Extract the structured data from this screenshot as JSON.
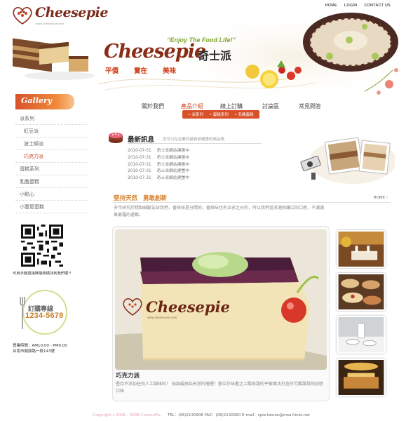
{
  "toplinks": [
    "HOME",
    "LOGIN",
    "CONTACT US"
  ],
  "logo": {
    "text": "Cheesepie",
    "url": "www.cheese-pie.com"
  },
  "banner": {
    "slogan": "“Enjoy The Food Life!”",
    "brand": "Cheesepie",
    "brand_cn": "奇士派",
    "tagline": [
      "平價",
      "實在",
      "美味"
    ]
  },
  "nav": {
    "items": [
      "關於我們",
      "產品介紹",
      "線上訂購",
      "討論區",
      "常見問答"
    ],
    "active_index": 1,
    "sub": [
      "派系列",
      "蛋糕系列",
      "乳酪蛋糕"
    ]
  },
  "gallery_label": "Gallery",
  "sidebar": [
    {
      "label": "派系列",
      "level": "top"
    },
    {
      "label": "紅豆派",
      "level": "sub"
    },
    {
      "label": "波士頓派",
      "level": "sub"
    },
    {
      "label": "巧克力派",
      "level": "sub",
      "active": true
    },
    {
      "label": "蛋糕系列",
      "level": "top"
    },
    {
      "label": "乳酪蛋糕",
      "level": "top"
    },
    {
      "label": "小點心",
      "level": "top"
    },
    {
      "label": "小豐屋蛋糕",
      "level": "top"
    }
  ],
  "qr_caption": "可用手機直接掃描條碼找到我們喔!!",
  "hotline": {
    "label": "訂購專線",
    "number": "1234-5678"
  },
  "hours": [
    "營業時間：AM10:00 - PM9:00",
    "台南市健康路一段143號"
  ],
  "news": {
    "title": "最新訊息",
    "subtitle": "您可以在這看到最新最優惠的商品唷",
    "items": [
      {
        "date": "2010-07-31",
        "text": "奇士派網站建置中"
      },
      {
        "date": "2010-07-31",
        "text": "奇士派網站建置中"
      },
      {
        "date": "2010-07-31",
        "text": "奇士派網站建置中"
      },
      {
        "date": "2010-07-31",
        "text": "奇士派網站建置中"
      },
      {
        "date": "2010-07-31",
        "text": "奇士派網站建置中"
      }
    ]
  },
  "intro": {
    "title_a": "堅持天然",
    "title_b": "勇敢創新",
    "home": "HOME",
    "text": "多年研究於精點細膩告訴我們，香與味是分開的，香與味也有正邪之分的，所以我們追求適與嫌口的口感，不濃讓東敢羅的還都。"
  },
  "feature": {
    "name": "巧克力派",
    "desc": "堅持不添加任何人工調味料！ 強調最原始天然的嗜裡！基立於味蕾之上酸與甜的平衡魔法打造芬芳酸甜甜的初戀口味",
    "brand": "Cheesepie",
    "brand_url": "www.cheese-pie.com"
  },
  "footer": {
    "copyright": "Copyright c 2006 - 2008 CheesePie",
    "contact": "TEL：(06)2130906 FAX：(06)2130950 E-mail：cpie.tainan@msa.hinet.net"
  },
  "colors": {
    "accent": "#d8512a",
    "brand": "#8a2d17",
    "green": "#7ea32b",
    "gold": "#c8802a"
  }
}
